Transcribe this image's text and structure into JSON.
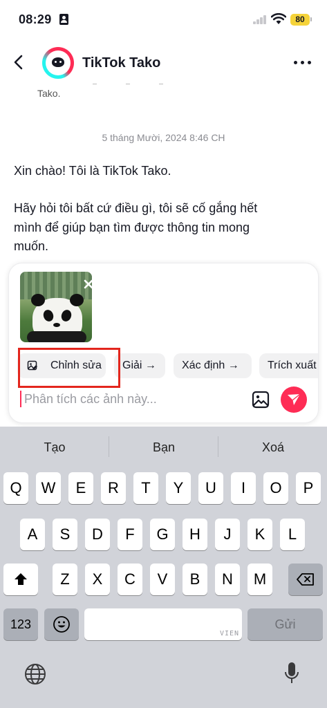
{
  "status_bar": {
    "time": "08:29",
    "battery": "80"
  },
  "header": {
    "title": "TikTok Tako"
  },
  "chat": {
    "cut_text": "Tako.",
    "timestamp": "5 tháng Mười, 2024 8:46 CH",
    "greeting": "Xin chào! Tôi là TikTok Tako.",
    "message_line1": "Hãy hỏi tôi bất cứ điều gì, tôi sẽ cố gắng hết",
    "message_line2": "mình để giúp bạn tìm được thông tin mong",
    "message_line3": "muốn."
  },
  "composer": {
    "chips": {
      "edit": "Chỉnh sửa",
      "explain": "Giải →",
      "identify": "Xác định →",
      "extract": "Trích xuất"
    },
    "input_placeholder": "Phân tích các ảnh này...",
    "accent_color": "#fe2c55"
  },
  "keyboard": {
    "suggestions": [
      "Tạo",
      "Bạn",
      "Xoá"
    ],
    "row1": [
      "Q",
      "W",
      "E",
      "R",
      "T",
      "Y",
      "U",
      "I",
      "O",
      "P"
    ],
    "row2": [
      "A",
      "S",
      "D",
      "F",
      "G",
      "H",
      "J",
      "K",
      "L"
    ],
    "row3": [
      "Z",
      "X",
      "C",
      "V",
      "B",
      "N",
      "M"
    ],
    "numbers_label": "123",
    "language_label": "VIEN",
    "send_label": "Gửi"
  }
}
